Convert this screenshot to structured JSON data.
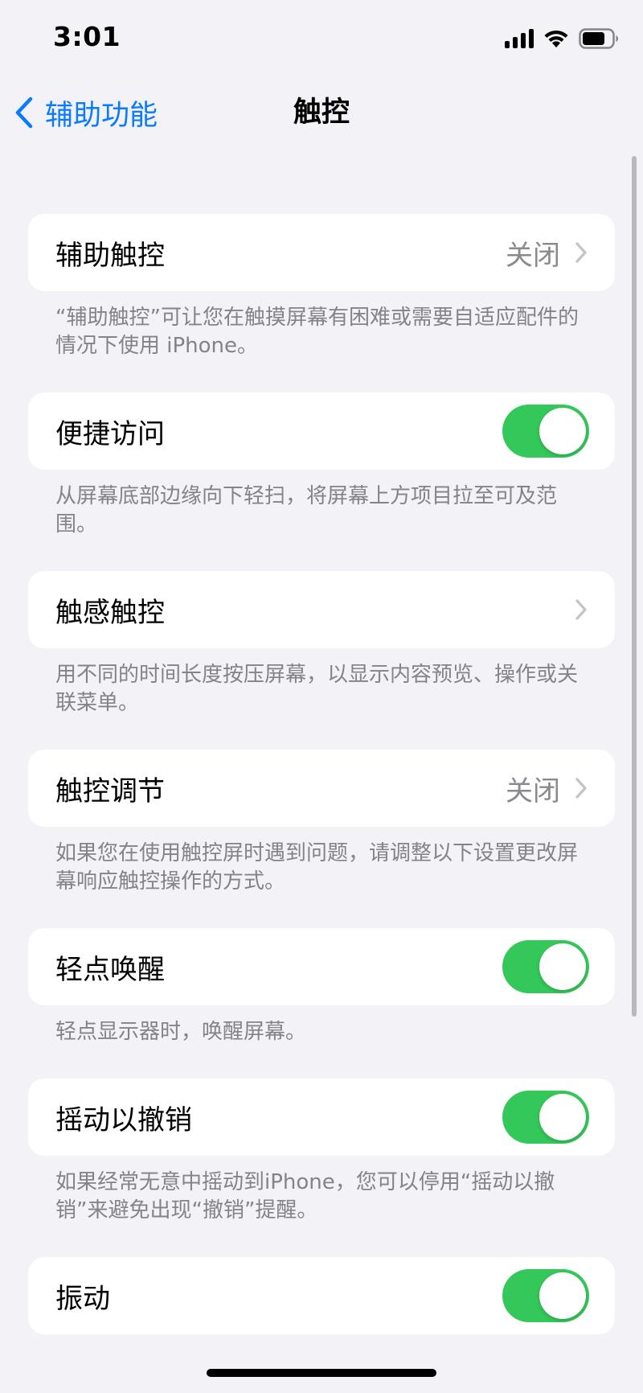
{
  "status_bar": {
    "time": "3:01"
  },
  "nav": {
    "back_label": "辅助功能",
    "title": "触控"
  },
  "colors": {
    "accent": "#0a7aff",
    "toggle_on": "#34c759",
    "background": "#f2f2f7"
  },
  "settings": [
    {
      "label": "辅助触控",
      "value": "关闭",
      "type": "disclosure",
      "footer": "“辅助触控”可让您在触摸屏幕有困难或需要自适应配件的情况下使用 iPhone。"
    },
    {
      "label": "便捷访问",
      "type": "toggle",
      "on": true,
      "footer": "从屏幕底部边缘向下轻扫，将屏幕上方项目拉至可及范围。"
    },
    {
      "label": "触感触控",
      "value": "",
      "type": "disclosure",
      "footer": "用不同的时间长度按压屏幕，以显示内容预览、操作或关联菜单。"
    },
    {
      "label": "触控调节",
      "value": "关闭",
      "type": "disclosure",
      "footer": "如果您在使用触控屏时遇到问题，请调整以下设置更改屏幕响应触控操作的方式。"
    },
    {
      "label": "轻点唤醒",
      "type": "toggle",
      "on": true,
      "footer": "轻点显示器时，唤醒屏幕。"
    },
    {
      "label": "摇动以撤销",
      "type": "toggle",
      "on": true,
      "footer": "如果经常无意中摇动到iPhone，您可以停用“摇动以撤销”来避免出现“撤销”提醒。"
    },
    {
      "label": "振动",
      "type": "toggle",
      "on": true,
      "footer": ""
    }
  ]
}
